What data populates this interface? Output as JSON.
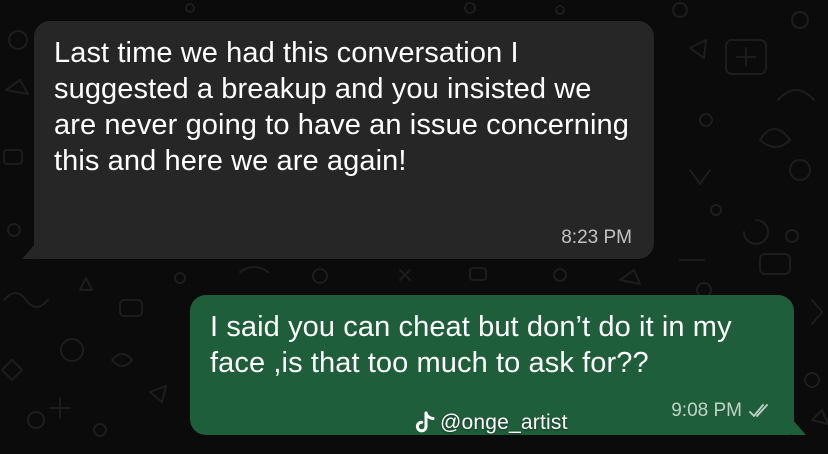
{
  "chat": {
    "messages": [
      {
        "direction": "incoming",
        "text": "Last time we had this conversation I suggested a breakup and you insisted we are never going to have an issue concerning this and here we are again!",
        "time": "8:23 PM"
      },
      {
        "direction": "outgoing",
        "text": "I said you can cheat but don’t do it in my face ,is that too much to ask for??",
        "time": "9:08 PM",
        "status_icon": "double-check-icon"
      }
    ]
  },
  "watermark": {
    "icon": "tiktok-icon",
    "handle": "@onge_artist"
  },
  "colors": {
    "background": "#0b0b0b",
    "incoming_bubble": "#262626",
    "outgoing_bubble": "#1f5e3b",
    "text": "#ffffff",
    "meta_text": "#b8b8b8"
  }
}
